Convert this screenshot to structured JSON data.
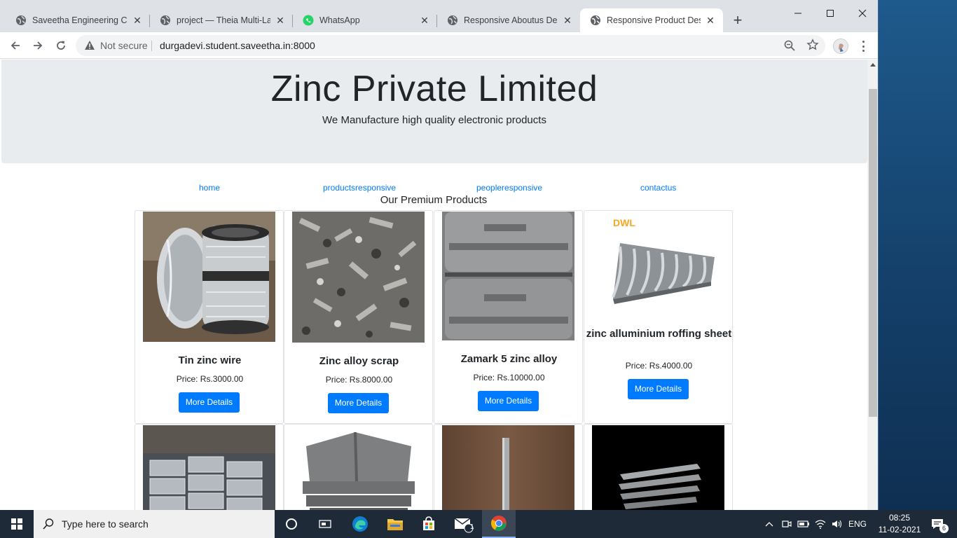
{
  "browser": {
    "tabs": [
      {
        "title": "Saveetha Engineering College"
      },
      {
        "title": "project — Theia Multi-Language"
      },
      {
        "title": "WhatsApp"
      },
      {
        "title": "Responsive Aboutus Design"
      },
      {
        "title": "Responsive Product Design",
        "active": true
      }
    ],
    "security_label": "Not secure",
    "url": "durgadevi.student.saveetha.in:8000"
  },
  "page": {
    "company_name": "Zinc Private Limited",
    "tagline": "We Manufacture high quality electronic products",
    "nav": [
      {
        "label": "home"
      },
      {
        "label": "productsresponsive"
      },
      {
        "label": "peopleresponsive"
      },
      {
        "label": "contactus"
      }
    ],
    "section_title": "Our Premium Products",
    "products": [
      {
        "name": "Tin zinc wire",
        "price": "Price: Rs.3000.00",
        "button": "More Details"
      },
      {
        "name": "Zinc alloy scrap",
        "price": "Price: Rs.8000.00",
        "button": "More Details"
      },
      {
        "name": "Zamark 5 zinc alloy",
        "price": "Price: Rs.10000.00",
        "button": "More Details"
      },
      {
        "name": "zinc alluminium roffing sheet",
        "price": "Price: Rs.4000.00",
        "button": "More Details",
        "image_logo": "DWL"
      }
    ]
  },
  "taskbar": {
    "search_placeholder": "Type here to search",
    "language": "ENG",
    "time": "08:25",
    "date": "11-02-2021",
    "mail_badge": "1",
    "notification_count": "6"
  }
}
